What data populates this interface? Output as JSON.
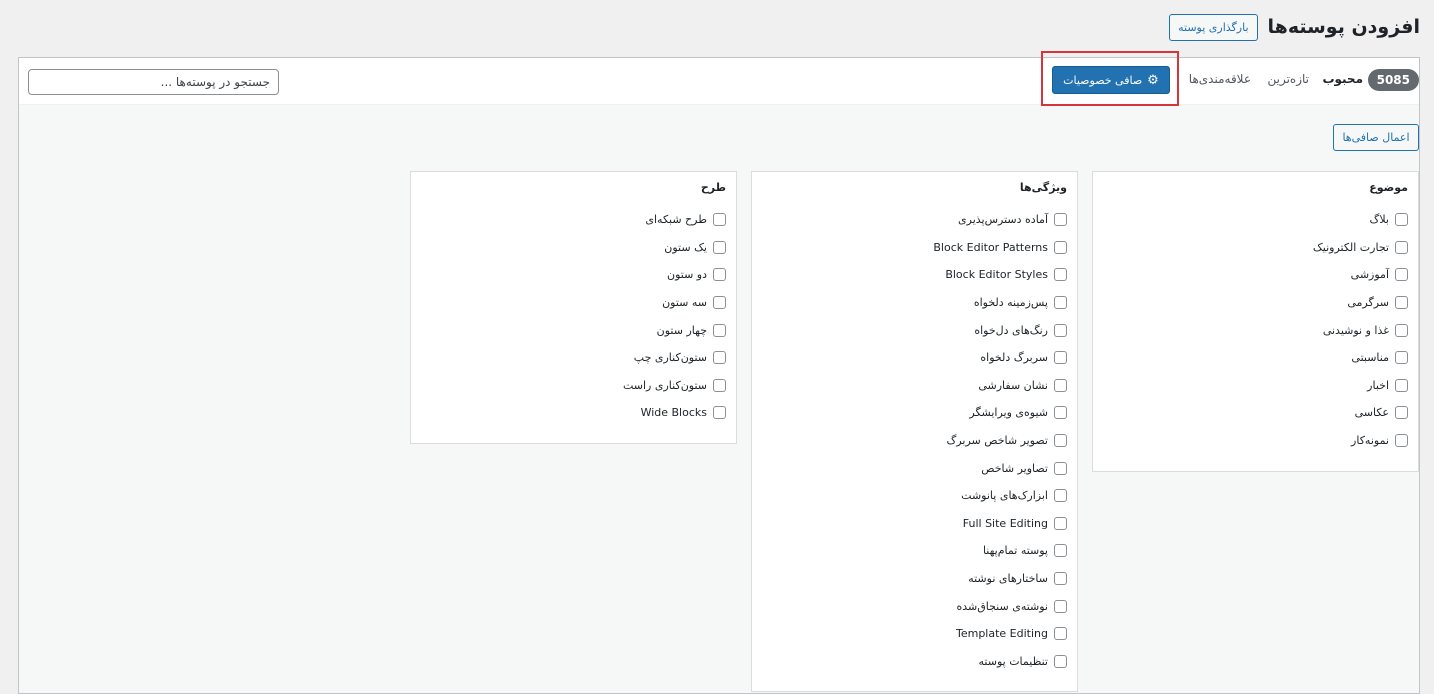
{
  "header": {
    "title": "افزودن پوسته‌ها",
    "upload_label": "بارگذاری پوسته"
  },
  "toolbar": {
    "count": "5085",
    "tabs": [
      "محبوب",
      "تازه‌ترین",
      "علاقه‌مندی‌ها"
    ],
    "filter_label": "صافی خصوصیات",
    "search_placeholder": "جستجو در پوسته‌ها ..."
  },
  "apply_label": "اعمال صافی‌ها",
  "groups": {
    "topic": {
      "title": "موضوع",
      "items": [
        "بلاگ",
        "تجارت الکترونیک",
        "آموزشی",
        "سرگرمی",
        "غذا و نوشیدنی",
        "مناسبتی",
        "اخبار",
        "عکاسی",
        "نمونه‌کار"
      ]
    },
    "features": {
      "title": "ویژگی‌ها",
      "items": [
        "آماده دسترس‌پذیری",
        "Block Editor Patterns",
        "Block Editor Styles",
        "پس‌زمینه دلخواه",
        "رنگ‌های دل‌خواه",
        "سربرگ دلخواه",
        "نشان سفارشی",
        "شیوه‌ی ویرایشگر",
        "تصویر شاخص سربرگ",
        "تصاویر شاخص",
        "ابزارک‌های پانوشت",
        "Full Site Editing",
        "پوسته تمام‌پهنا",
        "ساختارهای نوشته",
        "نوشته‌ی سنجاق‌شده",
        "Template Editing",
        "تنظیمات پوسته"
      ]
    },
    "layout": {
      "title": "طرح",
      "items": [
        "طرح شبکه‌ای",
        "یک ستون",
        "دو ستون",
        "سه ستون",
        "چهار ستون",
        "ستون‌کناری چپ",
        "ستون‌کناری راست",
        "Wide Blocks"
      ]
    }
  },
  "colors": {
    "primary": "#2271b1",
    "highlight": "#d63638",
    "badge": "#646970"
  }
}
